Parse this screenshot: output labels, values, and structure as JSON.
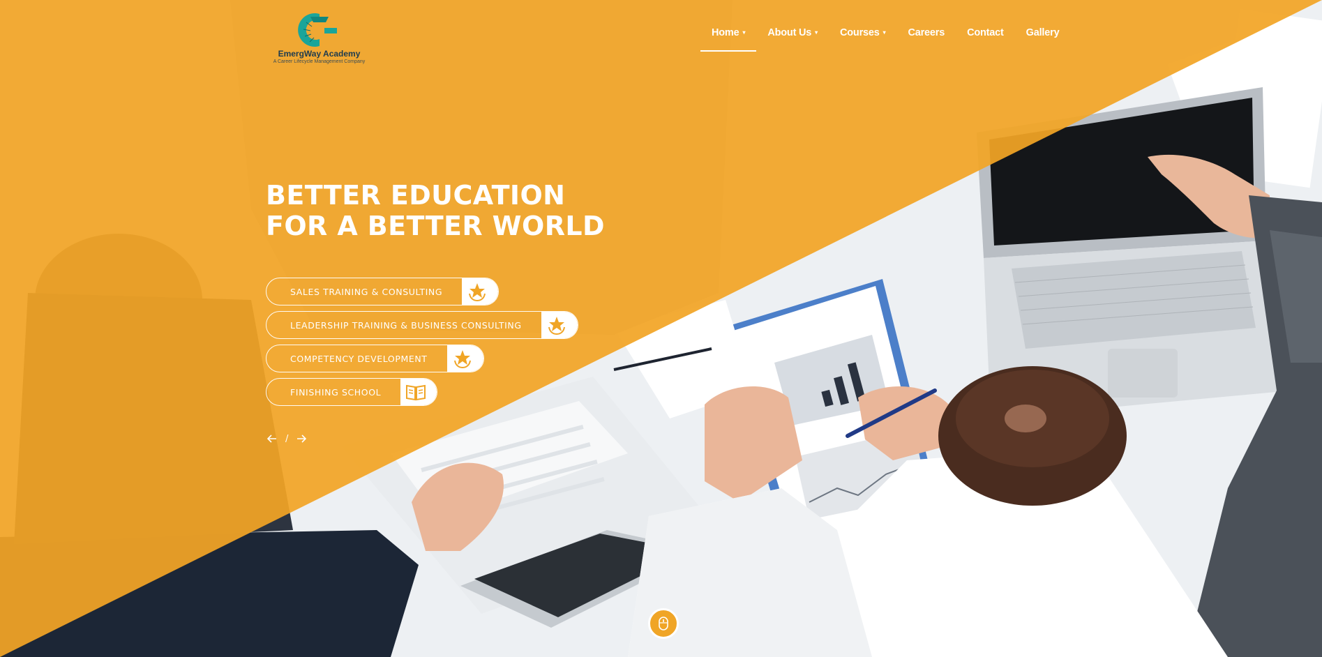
{
  "brand": {
    "name": "EmergWay Academy",
    "tagline": "A Career Lifecycle Management Company",
    "logo_icon": "emergway-logo-icon"
  },
  "nav": {
    "items": [
      {
        "label": "Home",
        "has_dropdown": true,
        "active": true
      },
      {
        "label": "About Us",
        "has_dropdown": true,
        "active": false
      },
      {
        "label": "Courses",
        "has_dropdown": true,
        "active": false
      },
      {
        "label": "Careers",
        "has_dropdown": false,
        "active": false
      },
      {
        "label": "Contact",
        "has_dropdown": false,
        "active": false
      },
      {
        "label": "Gallery",
        "has_dropdown": false,
        "active": false
      }
    ],
    "caret": "▾"
  },
  "hero": {
    "headline_line1": "BETTER EDUCATION",
    "headline_line2": "FOR A BETTER WORLD",
    "courses": [
      {
        "label": "SALES TRAINING & CONSULTING",
        "icon": "star-hands-icon"
      },
      {
        "label": "LEADERSHIP TRAINING & BUSINESS CONSULTING",
        "icon": "star-hands-icon"
      },
      {
        "label": "COMPETENCY DEVELOPMENT",
        "icon": "star-hands-icon"
      },
      {
        "label": "FINISHING SCHOOL",
        "icon": "open-book-icon"
      }
    ],
    "slider_separator": "/",
    "prev_icon": "arrow-left-icon",
    "next_icon": "arrow-right-icon",
    "scroll_icon": "mouse-icon"
  },
  "colors": {
    "accent": "#f0a526",
    "overlay": "#f2a526",
    "white": "#ffffff",
    "logo_teal": "#1aa59a"
  }
}
